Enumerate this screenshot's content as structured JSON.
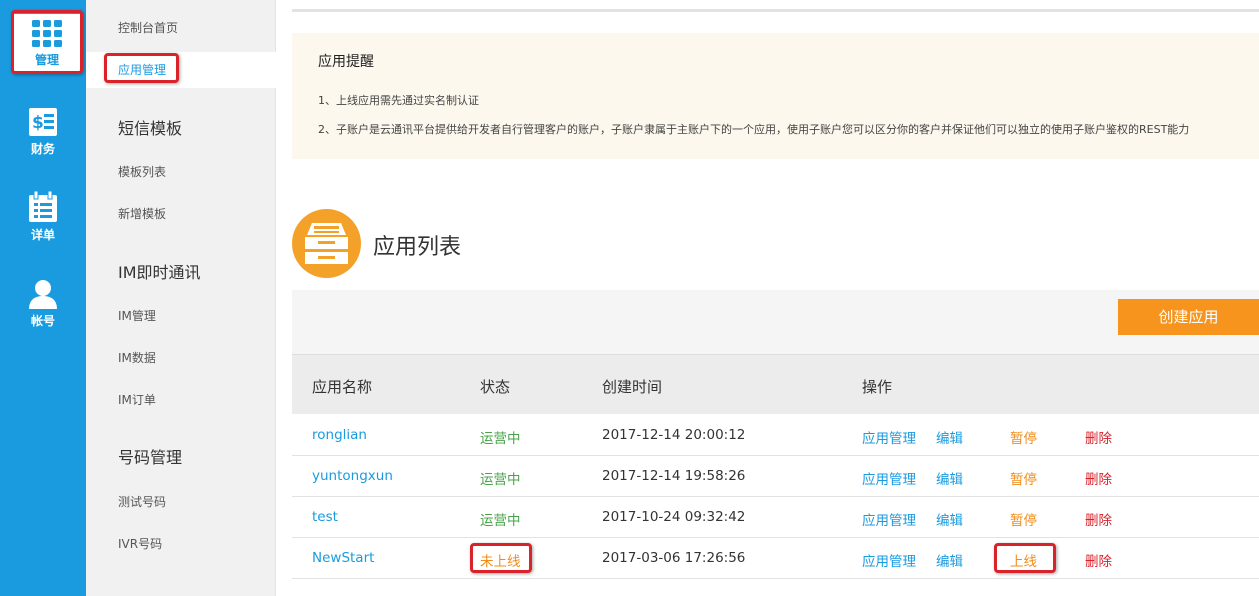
{
  "rail": {
    "items": [
      {
        "label": "管理",
        "icon": "grid-icon",
        "active": true
      },
      {
        "label": "财务",
        "icon": "dollar-doc-icon"
      },
      {
        "label": "详单",
        "icon": "calendar-list-icon"
      },
      {
        "label": "帐号",
        "icon": "user-icon"
      }
    ]
  },
  "menu": {
    "console_home": "控制台首页",
    "app_manage": "应用管理",
    "sms_group": "短信模板",
    "template_list": "模板列表",
    "add_template": "新增模板",
    "im_group": "IM即时通讯",
    "im_manage": "IM管理",
    "im_data": "IM数据",
    "im_order": "IM订单",
    "number_group": "号码管理",
    "test_number": "测试号码",
    "ivr_number": "IVR号码"
  },
  "notice": {
    "title": "应用提醒",
    "line1": "1、上线应用需先通过实名制认证",
    "line2": "2、子账户是云通讯平台提供给开发者自行管理客户的账户，子账户隶属于主账户下的一个应用，使用子账户您可以区分你的客户并保证他们可以独立的使用子账户鉴权的REST能力"
  },
  "app_list": {
    "title": "应用列表",
    "create_button": "创建应用",
    "columns": {
      "name": "应用名称",
      "status": "状态",
      "created": "创建时间",
      "actions": "操作"
    },
    "rows": [
      {
        "name": "ronglian",
        "status": "运营中",
        "created": "2017-12-14 20:00:12",
        "manage": "应用管理",
        "edit": "编辑",
        "toggle": "暂停",
        "delete": "删除"
      },
      {
        "name": "yuntongxun",
        "status": "运营中",
        "created": "2017-12-14 19:58:26",
        "manage": "应用管理",
        "edit": "编辑",
        "toggle": "暂停",
        "delete": "删除"
      },
      {
        "name": "test",
        "status": "运营中",
        "created": "2017-10-24 09:32:42",
        "manage": "应用管理",
        "edit": "编辑",
        "toggle": "暂停",
        "delete": "删除"
      },
      {
        "name": "NewStart",
        "status": "未上线",
        "created": "2017-03-06 17:26:56",
        "manage": "应用管理",
        "edit": "编辑",
        "toggle": "上线",
        "delete": "删除"
      }
    ]
  },
  "colors": {
    "primary": "#1a9be0",
    "accent": "#f7941d",
    "running": "#4aa34a",
    "danger": "#d9222a",
    "highlight": "#d9222a"
  }
}
